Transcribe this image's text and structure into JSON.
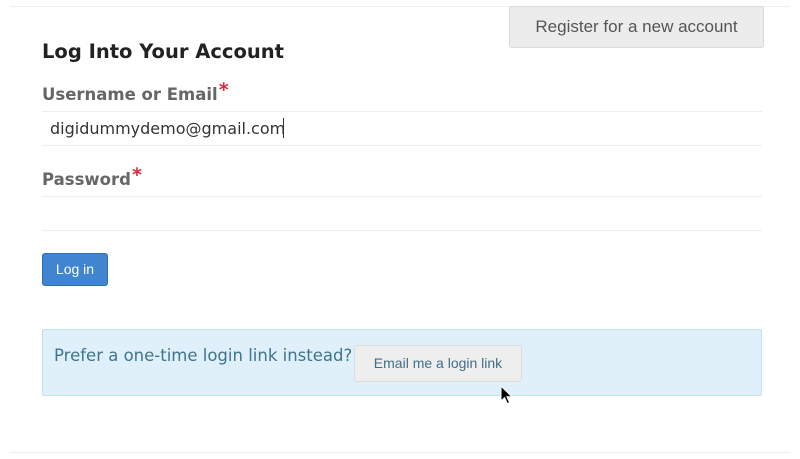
{
  "header": {
    "register_label": "Register for a new account",
    "title": "Log Into Your Account"
  },
  "form": {
    "username": {
      "label": "Username or Email",
      "required_marker": "*",
      "value": "digidummydemo@gmail.com"
    },
    "password": {
      "label": "Password",
      "required_marker": "*",
      "value": ""
    },
    "login_label": "Log in"
  },
  "login_link": {
    "prompt": "Prefer a one-time login link instead?",
    "button_label": "Email me a login link"
  },
  "colors": {
    "primary_button": "#3f85d0",
    "required_marker": "#e0283b",
    "info_background": "#dff0fb",
    "info_text": "#3f7390"
  },
  "icons": {
    "pointer": "mouse-pointer-icon"
  }
}
